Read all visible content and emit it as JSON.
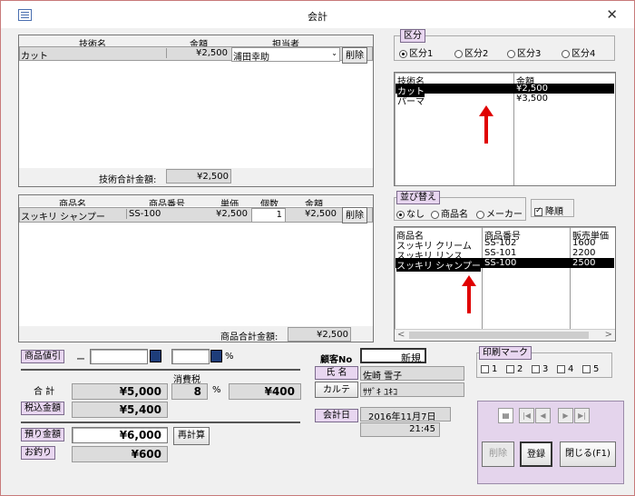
{
  "window": {
    "title": "会計",
    "close": "✕"
  },
  "tech": {
    "headers": [
      "技術名",
      "金額",
      "担当者"
    ],
    "row": {
      "name": "カット",
      "amount": "¥2,500",
      "staff": "浦田幸助",
      "delete": "削除"
    },
    "total_label": "技術合計金額:",
    "total": "¥2,500"
  },
  "goods": {
    "headers": [
      "商品名",
      "商品番号",
      "単価",
      "個数",
      "金額"
    ],
    "row": {
      "name": "スッキリ シャンプー",
      "code": "SS-100",
      "price": "¥2,500",
      "qty": "1",
      "amount": "¥2,500",
      "delete": "削除"
    },
    "total_label": "商品合計金額:",
    "total": "¥2,500"
  },
  "category": {
    "title": "区分",
    "options": [
      "区分1",
      "区分2",
      "区分3",
      "区分4"
    ],
    "selected": 0
  },
  "tech_list": {
    "headers": [
      "技術名",
      "金額"
    ],
    "rows": [
      {
        "name": "カット",
        "amount": "¥2,500",
        "selected": true
      },
      {
        "name": "パーマ",
        "amount": "¥3,500",
        "selected": false
      }
    ]
  },
  "sort": {
    "title": "並び替え",
    "options": [
      "なし",
      "商品名",
      "メーカー"
    ],
    "selected": 0,
    "desc_label": "降順",
    "desc_checked": true
  },
  "goods_list": {
    "headers": [
      "商品名",
      "商品番号",
      "販売単価"
    ],
    "rows": [
      {
        "name": "スッキリ クリーム",
        "code": "SS-102",
        "price": "1600",
        "selected": false
      },
      {
        "name": "スッキリ リンス",
        "code": "SS-101",
        "price": "2200",
        "selected": false
      },
      {
        "name": "スッキリ シャンプー",
        "code": "SS-100",
        "price": "2500",
        "selected": true
      }
    ]
  },
  "discount": {
    "label": "商品値引",
    "dash": "ー",
    "pct": "%"
  },
  "totals": {
    "subtotal_label": "合 計",
    "subtotal": "¥5,000",
    "tax_label": "消費税",
    "tax_rate": "8",
    "tax_pct": "%",
    "tax": "¥400",
    "taxin_label": "税込金額",
    "taxin": "¥5,400",
    "deposit_label": "預り金額",
    "deposit": "¥6,000",
    "recalc": "再計算",
    "change_label": "お釣り",
    "change": "¥600"
  },
  "customer": {
    "no_label": "顧客No",
    "no_value": "新規",
    "name_label": "氏 名",
    "name": "佐崎 雪子",
    "kana_button": "カルテ",
    "kana": "ｻｻﾞｷ ﾕｷｺ",
    "date_label": "会計日",
    "date": "2016年11月7日",
    "time": "21:45"
  },
  "print": {
    "title": "印刷マーク",
    "marks": [
      "1",
      "2",
      "3",
      "4",
      "5"
    ]
  },
  "actions": {
    "delete": "削除",
    "register": "登録",
    "close": "閉じる(F1)"
  },
  "colors": {
    "selection": "#000000",
    "arrow": "#e00000",
    "panel": "#e8d6f0"
  }
}
